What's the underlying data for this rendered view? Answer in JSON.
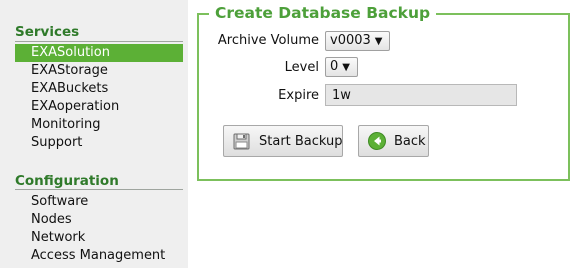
{
  "sidebar": {
    "services_title": "Services",
    "services_items": [
      "EXASolution",
      "EXAStorage",
      "EXABuckets",
      "EXAoperation",
      "Monitoring",
      "Support"
    ],
    "configuration_title": "Configuration",
    "configuration_items": [
      "Software",
      "Nodes",
      "Network",
      "Access Management"
    ],
    "active_item": "EXASolution"
  },
  "form": {
    "title": "Create Database Backup",
    "archive_volume_label": "Archive Volume",
    "archive_volume_value": "v0003",
    "level_label": "Level",
    "level_value": "0",
    "expire_label": "Expire",
    "expire_value": "1w",
    "start_backup_label": "Start Backup",
    "back_label": "Back"
  },
  "colors": {
    "accent_green": "#5cb036",
    "title_green": "#4da03a",
    "sidebar_bg": "#efefef"
  },
  "icons": {
    "start_backup": "disk-backup-icon",
    "back": "green-back-arrow-icon"
  }
}
